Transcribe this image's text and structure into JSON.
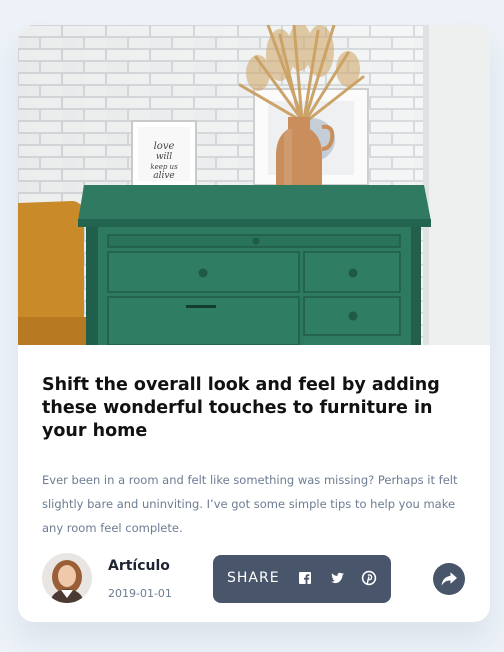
{
  "hero_image": {
    "label": "love will keep us alive"
  },
  "article": {
    "title": "Shift the overall look and feel by adding these wonderful touches to furniture in your home",
    "description": "Ever been in a room and felt like something was missing? Perhaps it felt slightly bare and uninviting. I’ve got some simple tips to help you make any room feel complete."
  },
  "author": {
    "name": "Artículo",
    "date": "2019-01-01"
  },
  "share": {
    "label": "SHARE",
    "networks": [
      "facebook-icon",
      "twitter-icon",
      "pinterest-icon"
    ]
  },
  "colors": {
    "page_bg": "#ecf2f8",
    "dark": "#48556a",
    "muted_text": "#6c7c93",
    "title_text": "#111111"
  }
}
